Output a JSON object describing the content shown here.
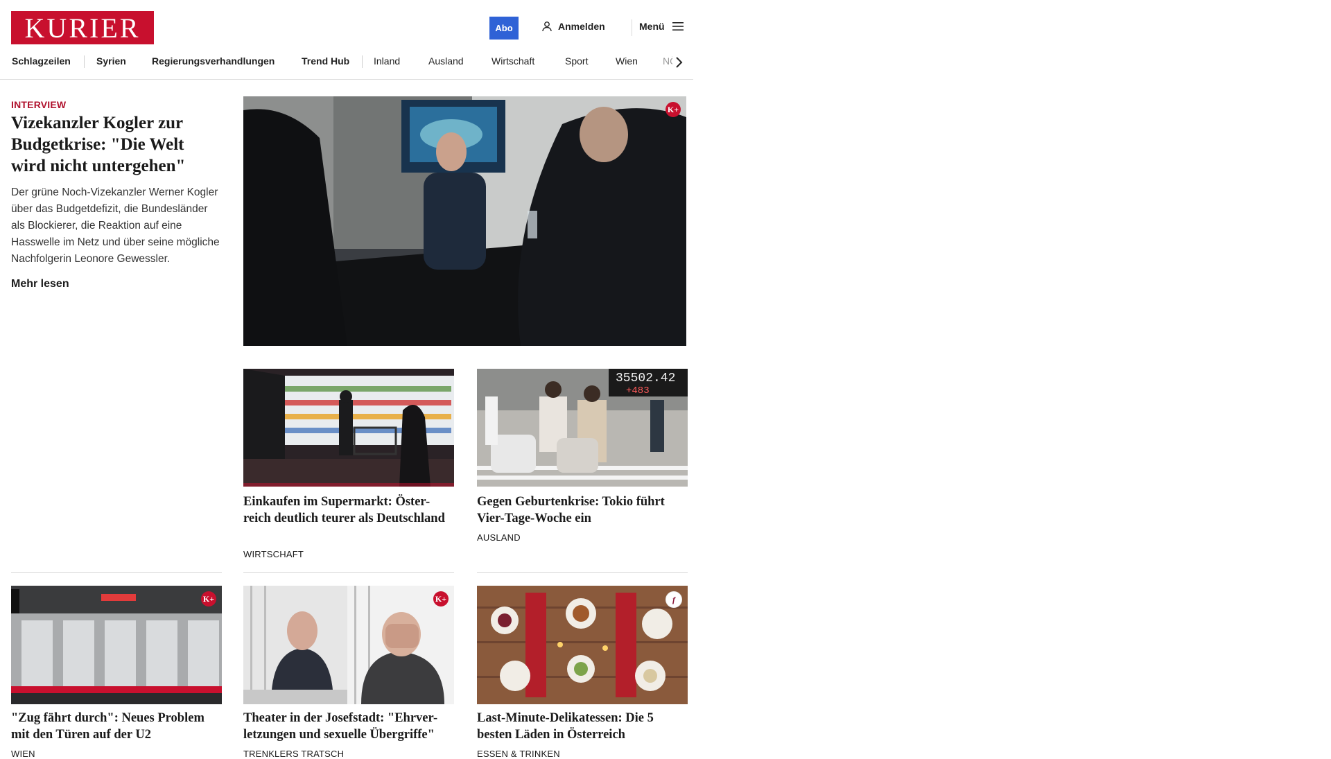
{
  "header": {
    "logo": "KURIER",
    "abo_label": "Abo",
    "login_label": "Anmelden",
    "menu_label": "Menü",
    "brand_color": "#c8102e",
    "abo_color": "#2f62d6"
  },
  "nav": {
    "items": [
      "Schlagzeilen",
      "Syrien",
      "Regierungsverhandlungen",
      "Trend Hub",
      "Inland",
      "Ausland",
      "Wirtschaft",
      "Sport",
      "Wien",
      "NÖ"
    ]
  },
  "hero": {
    "kicker": "INTERVIEW",
    "title": "Vizekanzler Kogler zur Budgetkrise: \"Die Welt wird nicht untergehen\"",
    "text": "Der grüne Noch-Vizekanzler Werner Kogler über das Budgetdefizit, die Bundesländer als Blockierer, die Reaktion auf eine Hasswelle im Netz und über seine mögliche Nachfolgerin Leonore Gewessler.",
    "more": "Mehr lesen",
    "badge": "K+"
  },
  "cards": [
    {
      "title": "Einkaufen im Supermarkt: Öster-reich deutlich teurer als Deutschland",
      "category": "WIRTSCHAFT"
    },
    {
      "title": "Gegen Geburtenkrise: Tokio führt Vier-Tage-Woche ein",
      "category": "AUSLAND",
      "ticker": "35502.42",
      "ticker_change": "+483"
    },
    {
      "title": "\"Zug fährt durch\": Neues Problem mit den Türen auf der U2",
      "category": "WIEN",
      "badge": "K+"
    },
    {
      "title": "Theater in der Josefstadt: \"Ehrver-letzungen und sexuelle Übergriffe\"",
      "category": "TRENKLERS TRATSCH",
      "badge": "K+"
    },
    {
      "title": "Last-Minute-Delikatessen: Die 5 besten Läden in Österreich",
      "category": "ESSEN & TRINKEN",
      "badge": "f"
    }
  ]
}
